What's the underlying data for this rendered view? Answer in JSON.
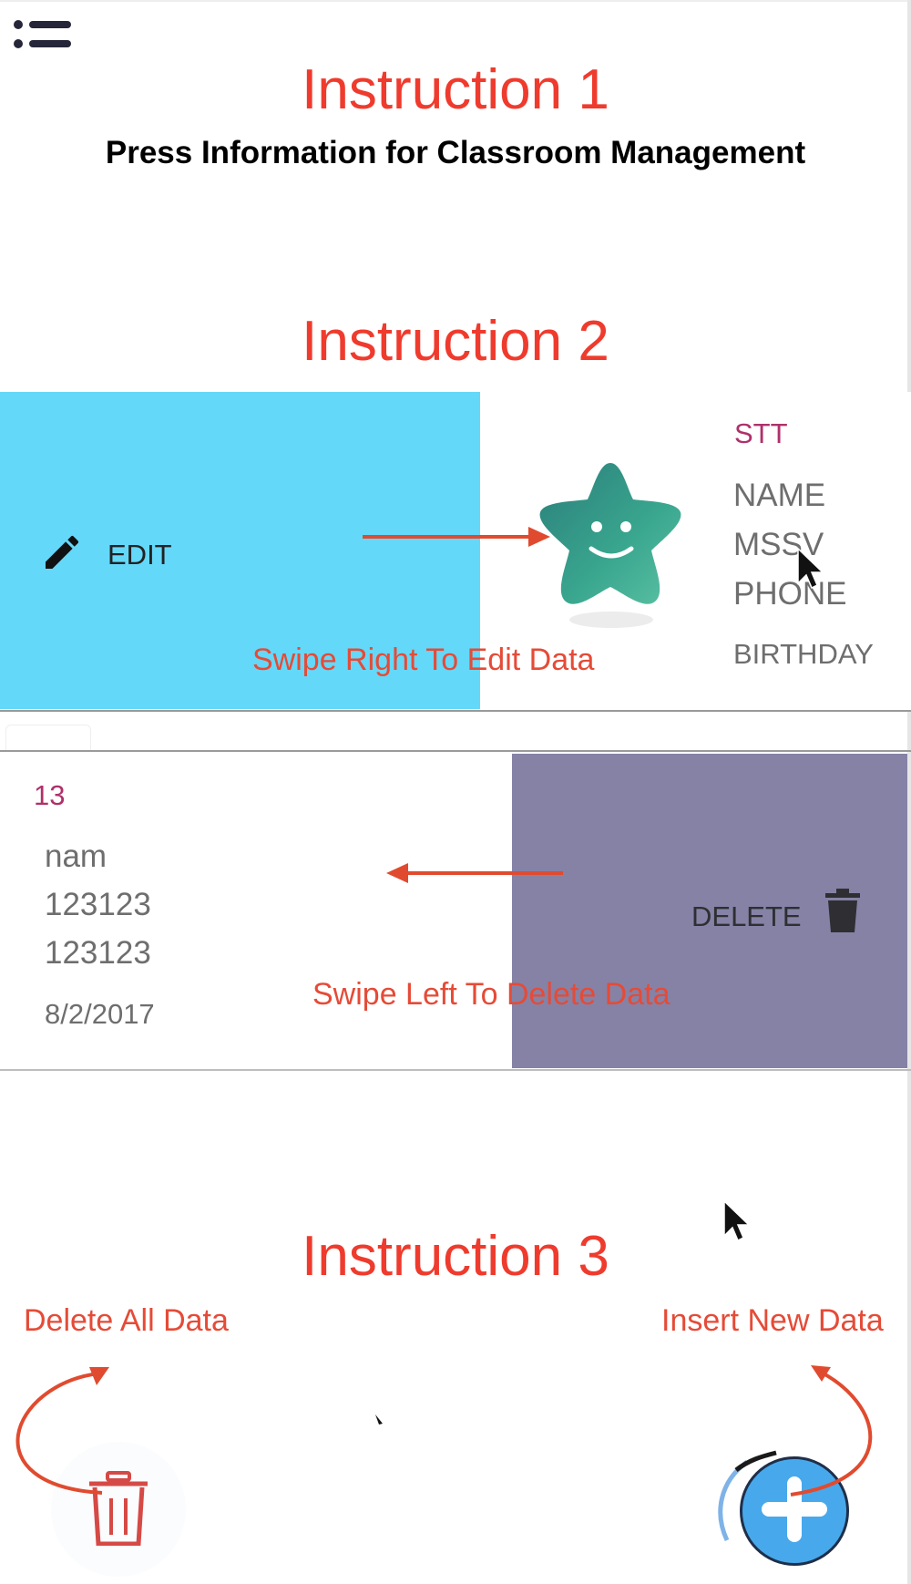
{
  "colors": {
    "annotation_red": "#ef3b2d",
    "edit_panel": "#64d8f8",
    "delete_panel": "#8582a6",
    "fab_blue": "#47a9ec",
    "stt_color": "#b0306a"
  },
  "header": {
    "menu_icon": "menu-list-icon",
    "instruction1_title": "Instruction 1",
    "instruction1_subtitle": "Press Information for Classroom Management"
  },
  "instruction2": {
    "title": "Instruction 2",
    "edit_label": "EDIT",
    "edit_icon": "pencil-icon",
    "avatar_icon": "smiling-star-icon",
    "fields": {
      "stt": "STT",
      "name": "NAME",
      "mssv": "MSSV",
      "phone": "PHONE",
      "birthday": "BIRTHDAY"
    },
    "swipe_right_text": "Swipe Right To Edit Data",
    "record": {
      "stt": "13",
      "name": "nam",
      "mssv": "123123",
      "phone": "123123",
      "birthday": "8/2/2017"
    },
    "delete_label": "DELETE",
    "delete_icon": "trash-icon",
    "swipe_left_text": "Swipe Left To Delete Data"
  },
  "instruction3": {
    "title": "Instruction 3",
    "delete_all_text": "Delete All Data",
    "insert_new_text": "Insert New Data",
    "delete_all_icon": "trash-icon",
    "add_icon": "plus-icon"
  }
}
